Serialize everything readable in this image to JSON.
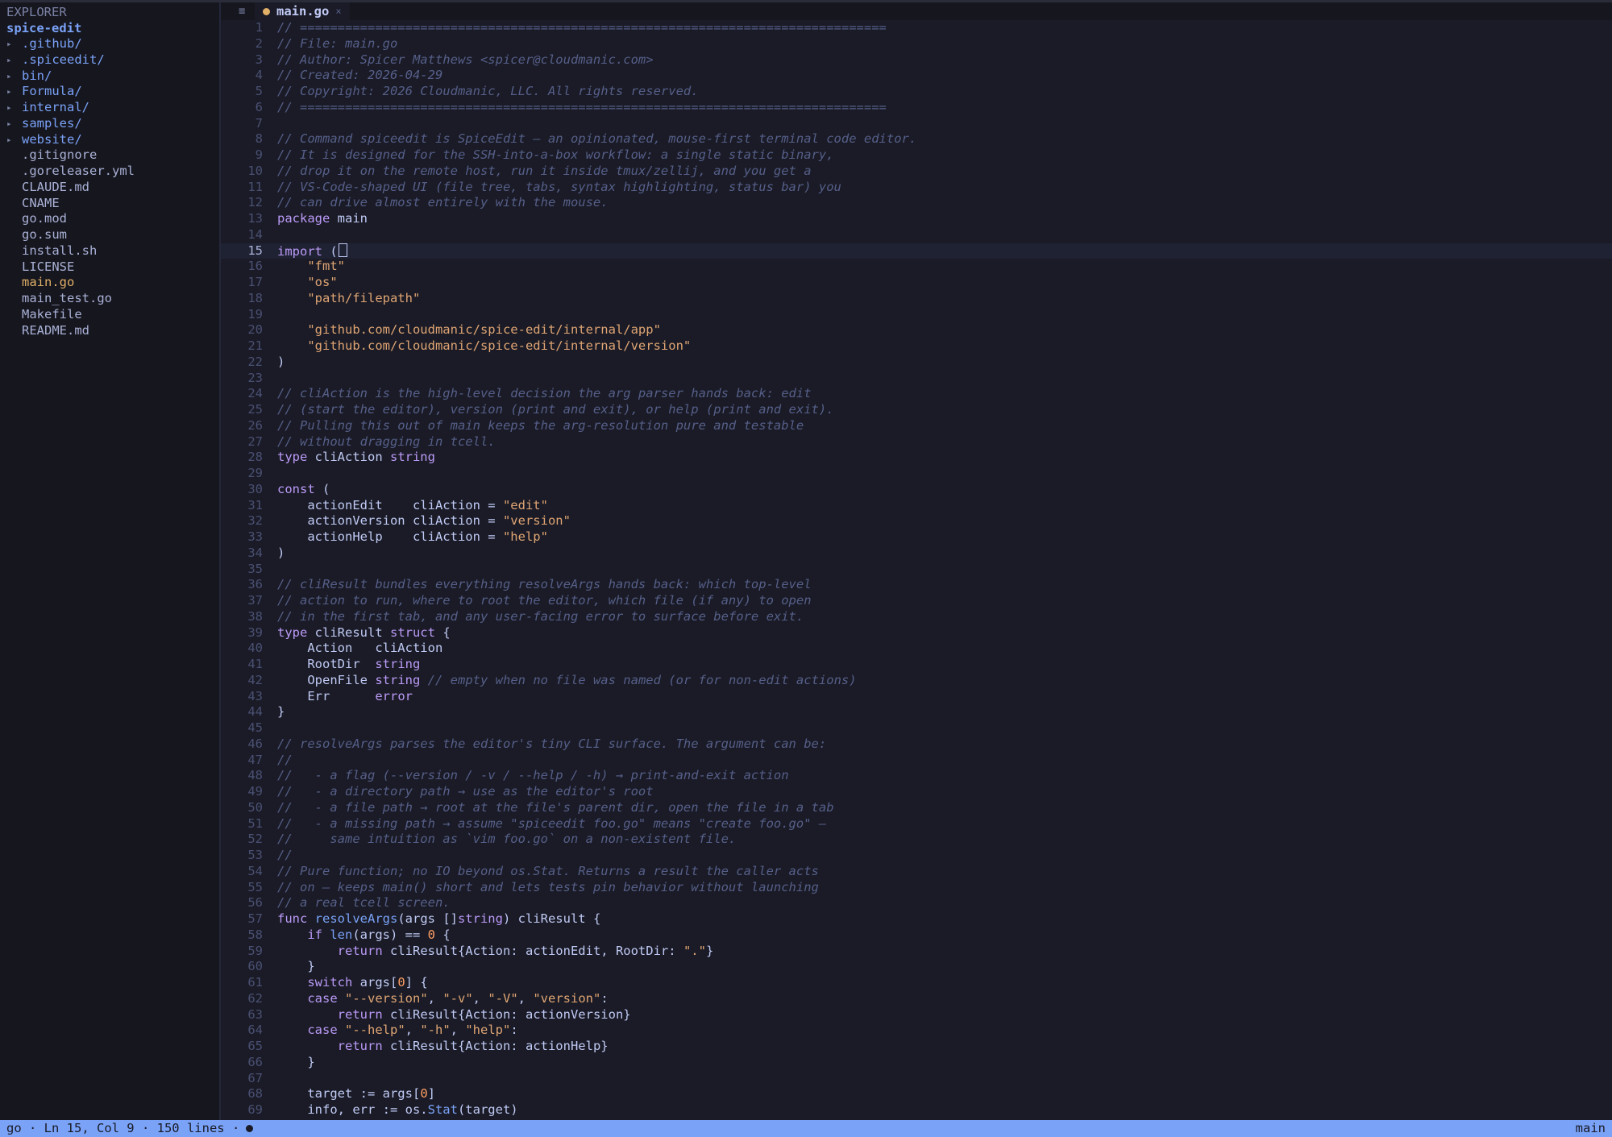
{
  "sidebar": {
    "title": "EXPLORER",
    "root": "spice-edit",
    "items": [
      {
        "name": ".github/",
        "kind": "dir"
      },
      {
        "name": ".spiceedit/",
        "kind": "dir"
      },
      {
        "name": "bin/",
        "kind": "dir"
      },
      {
        "name": "Formula/",
        "kind": "dir"
      },
      {
        "name": "internal/",
        "kind": "dir"
      },
      {
        "name": "samples/",
        "kind": "dir"
      },
      {
        "name": "website/",
        "kind": "dir"
      },
      {
        "name": ".gitignore",
        "kind": "file"
      },
      {
        "name": ".goreleaser.yml",
        "kind": "file"
      },
      {
        "name": "CLAUDE.md",
        "kind": "file"
      },
      {
        "name": "CNAME",
        "kind": "file"
      },
      {
        "name": "go.mod",
        "kind": "file"
      },
      {
        "name": "go.sum",
        "kind": "file"
      },
      {
        "name": "install.sh",
        "kind": "file"
      },
      {
        "name": "LICENSE",
        "kind": "file"
      },
      {
        "name": "main.go",
        "kind": "file",
        "active": true
      },
      {
        "name": "main_test.go",
        "kind": "file"
      },
      {
        "name": "Makefile",
        "kind": "file"
      },
      {
        "name": "README.md",
        "kind": "file"
      }
    ]
  },
  "tabs": {
    "menu_icon": "hamburger-menu-icon",
    "active": {
      "label": "main.go",
      "modified": true,
      "close_icon": "close-icon"
    }
  },
  "editor": {
    "cursor_line": 15,
    "lines": [
      [
        [
          "cmt",
          "// =============================================================================="
        ]
      ],
      [
        [
          "cmt",
          "// File: main.go"
        ]
      ],
      [
        [
          "cmt",
          "// Author: Spicer Matthews <spicer@cloudmanic.com>"
        ]
      ],
      [
        [
          "cmt",
          "// Created: 2026-04-29"
        ]
      ],
      [
        [
          "cmt",
          "// Copyright: 2026 Cloudmanic, LLC. All rights reserved."
        ]
      ],
      [
        [
          "cmt",
          "// =============================================================================="
        ]
      ],
      [],
      [
        [
          "cmt",
          "// Command spiceedit is SpiceEdit — an opinionated, mouse-first terminal code editor."
        ]
      ],
      [
        [
          "cmt",
          "// It is designed for the SSH-into-a-box workflow: a single static binary,"
        ]
      ],
      [
        [
          "cmt",
          "// drop it on the remote host, run it inside tmux/zellij, and you get a"
        ]
      ],
      [
        [
          "cmt",
          "// VS-Code-shaped UI (file tree, tabs, syntax highlighting, status bar) you"
        ]
      ],
      [
        [
          "cmt",
          "// can drive almost entirely with the mouse."
        ]
      ],
      [
        [
          "kw",
          "package"
        ],
        [
          "id",
          " main"
        ]
      ],
      [],
      [
        [
          "kw",
          "import"
        ],
        [
          "id",
          " ("
        ],
        [
          "cursor",
          ""
        ]
      ],
      [
        [
          "id",
          "    "
        ],
        [
          "str",
          "\"fmt\""
        ]
      ],
      [
        [
          "id",
          "    "
        ],
        [
          "str",
          "\"os\""
        ]
      ],
      [
        [
          "id",
          "    "
        ],
        [
          "str",
          "\"path/filepath\""
        ]
      ],
      [],
      [
        [
          "id",
          "    "
        ],
        [
          "str",
          "\"github.com/cloudmanic/spice-edit/internal/app\""
        ]
      ],
      [
        [
          "id",
          "    "
        ],
        [
          "str",
          "\"github.com/cloudmanic/spice-edit/internal/version\""
        ]
      ],
      [
        [
          "id",
          ")"
        ]
      ],
      [],
      [
        [
          "cmt",
          "// cliAction is the high-level decision the arg parser hands back: edit"
        ]
      ],
      [
        [
          "cmt",
          "// (start the editor), version (print and exit), or help (print and exit)."
        ]
      ],
      [
        [
          "cmt",
          "// Pulling this out of main keeps the arg-resolution pure and testable"
        ]
      ],
      [
        [
          "cmt",
          "// without dragging in tcell."
        ]
      ],
      [
        [
          "kw",
          "type"
        ],
        [
          "id",
          " cliAction "
        ],
        [
          "ty",
          "string"
        ]
      ],
      [],
      [
        [
          "kw",
          "const"
        ],
        [
          "id",
          " ("
        ]
      ],
      [
        [
          "id",
          "    actionEdit    cliAction = "
        ],
        [
          "str",
          "\"edit\""
        ]
      ],
      [
        [
          "id",
          "    actionVersion cliAction = "
        ],
        [
          "str",
          "\"version\""
        ]
      ],
      [
        [
          "id",
          "    actionHelp    cliAction = "
        ],
        [
          "str",
          "\"help\""
        ]
      ],
      [
        [
          "id",
          ")"
        ]
      ],
      [],
      [
        [
          "cmt",
          "// cliResult bundles everything resolveArgs hands back: which top-level"
        ]
      ],
      [
        [
          "cmt",
          "// action to run, where to root the editor, which file (if any) to open"
        ]
      ],
      [
        [
          "cmt",
          "// in the first tab, and any user-facing error to surface before exit."
        ]
      ],
      [
        [
          "kw",
          "type"
        ],
        [
          "id",
          " cliResult "
        ],
        [
          "kw",
          "struct"
        ],
        [
          "id",
          " {"
        ]
      ],
      [
        [
          "id",
          "    Action   cliAction"
        ]
      ],
      [
        [
          "id",
          "    RootDir  "
        ],
        [
          "ty",
          "string"
        ]
      ],
      [
        [
          "id",
          "    OpenFile "
        ],
        [
          "ty",
          "string"
        ],
        [
          "id",
          " "
        ],
        [
          "cmt",
          "// empty when no file was named (or for non-edit actions)"
        ]
      ],
      [
        [
          "id",
          "    Err      "
        ],
        [
          "ty",
          "error"
        ]
      ],
      [
        [
          "id",
          "}"
        ]
      ],
      [],
      [
        [
          "cmt",
          "// resolveArgs parses the editor's tiny CLI surface. The argument can be:"
        ]
      ],
      [
        [
          "cmt",
          "//"
        ]
      ],
      [
        [
          "cmt",
          "//   - a flag (--version / -v / --help / -h) → print-and-exit action"
        ]
      ],
      [
        [
          "cmt",
          "//   - a directory path → use as the editor's root"
        ]
      ],
      [
        [
          "cmt",
          "//   - a file path → root at the file's parent dir, open the file in a tab"
        ]
      ],
      [
        [
          "cmt",
          "//   - a missing path → assume \"spiceedit foo.go\" means \"create foo.go\" —"
        ]
      ],
      [
        [
          "cmt",
          "//     same intuition as `vim foo.go` on a non-existent file."
        ]
      ],
      [
        [
          "cmt",
          "//"
        ]
      ],
      [
        [
          "cmt",
          "// Pure function; no IO beyond os.Stat. Returns a result the caller acts"
        ]
      ],
      [
        [
          "cmt",
          "// on — keeps main() short and lets tests pin behavior without launching"
        ]
      ],
      [
        [
          "cmt",
          "// a real tcell screen."
        ]
      ],
      [
        [
          "kw",
          "func"
        ],
        [
          "id",
          " "
        ],
        [
          "fn",
          "resolveArgs"
        ],
        [
          "id",
          "(args []"
        ],
        [
          "ty",
          "string"
        ],
        [
          "id",
          ") cliResult {"
        ]
      ],
      [
        [
          "id",
          "    "
        ],
        [
          "kw",
          "if"
        ],
        [
          "id",
          " "
        ],
        [
          "fn",
          "len"
        ],
        [
          "id",
          "(args) == "
        ],
        [
          "num",
          "0"
        ],
        [
          "id",
          " {"
        ]
      ],
      [
        [
          "id",
          "        "
        ],
        [
          "kw",
          "return"
        ],
        [
          "id",
          " cliResult{Action: actionEdit, RootDir: "
        ],
        [
          "str",
          "\".\""
        ],
        [
          "id",
          "}"
        ]
      ],
      [
        [
          "id",
          "    }"
        ]
      ],
      [
        [
          "id",
          "    "
        ],
        [
          "kw",
          "switch"
        ],
        [
          "id",
          " args["
        ],
        [
          "num",
          "0"
        ],
        [
          "id",
          "] {"
        ]
      ],
      [
        [
          "id",
          "    "
        ],
        [
          "kw",
          "case"
        ],
        [
          "id",
          " "
        ],
        [
          "str",
          "\"--version\""
        ],
        [
          "id",
          ", "
        ],
        [
          "str",
          "\"-v\""
        ],
        [
          "id",
          ", "
        ],
        [
          "str",
          "\"-V\""
        ],
        [
          "id",
          ", "
        ],
        [
          "str",
          "\"version\""
        ],
        [
          "id",
          ":"
        ]
      ],
      [
        [
          "id",
          "        "
        ],
        [
          "kw",
          "return"
        ],
        [
          "id",
          " cliResult{Action: actionVersion}"
        ]
      ],
      [
        [
          "id",
          "    "
        ],
        [
          "kw",
          "case"
        ],
        [
          "id",
          " "
        ],
        [
          "str",
          "\"--help\""
        ],
        [
          "id",
          ", "
        ],
        [
          "str",
          "\"-h\""
        ],
        [
          "id",
          ", "
        ],
        [
          "str",
          "\"help\""
        ],
        [
          "id",
          ":"
        ]
      ],
      [
        [
          "id",
          "        "
        ],
        [
          "kw",
          "return"
        ],
        [
          "id",
          " cliResult{Action: actionHelp}"
        ]
      ],
      [
        [
          "id",
          "    }"
        ]
      ],
      [],
      [
        [
          "id",
          "    target := args["
        ],
        [
          "num",
          "0"
        ],
        [
          "id",
          "]"
        ]
      ],
      [
        [
          "id",
          "    info, err := os."
        ],
        [
          "fn",
          "Stat"
        ],
        [
          "id",
          "(target)"
        ]
      ]
    ]
  },
  "status": {
    "left": "go · Ln 15, Col 9 · 150 lines ·",
    "modified_dot_icon": "modified-dot-icon",
    "right": "main"
  },
  "colors": {
    "background": "#1a1b26",
    "sidebar": "#16161e",
    "accent": "#7aa2f7",
    "comment": "#565f89",
    "keyword": "#bb9af7",
    "string": "#e0a574",
    "modified": "#e0af68"
  }
}
